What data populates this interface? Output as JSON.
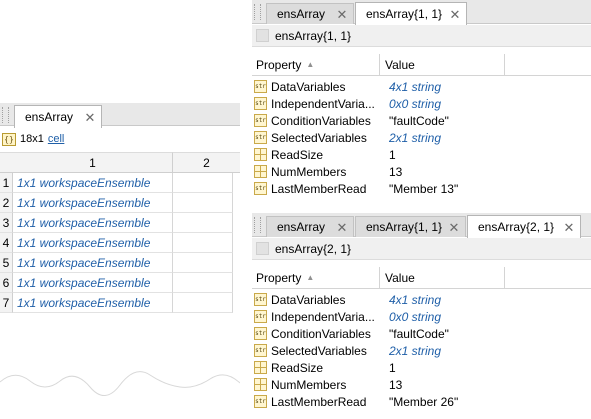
{
  "left_panel": {
    "tab_label": "ensArray",
    "size_text": "18x1",
    "class_link": "cell",
    "columns": [
      "1",
      "2"
    ],
    "rows": [
      {
        "index": "1",
        "value": "1x1 workspaceEnsemble"
      },
      {
        "index": "2",
        "value": "1x1 workspaceEnsemble"
      },
      {
        "index": "3",
        "value": "1x1 workspaceEnsemble"
      },
      {
        "index": "4",
        "value": "1x1 workspaceEnsemble"
      },
      {
        "index": "5",
        "value": "1x1 workspaceEnsemble"
      },
      {
        "index": "6",
        "value": "1x1 workspaceEnsemble"
      },
      {
        "index": "7",
        "value": "1x1 workspaceEnsemble"
      }
    ]
  },
  "top_right_panel": {
    "tabs": [
      "ensArray",
      "ensArray{1, 1}"
    ],
    "active_tab": 1,
    "variable_name": "ensArray{1, 1}",
    "header": {
      "property": "Property",
      "value": "Value"
    },
    "properties": [
      {
        "name": "DataVariables",
        "value": "4x1 string",
        "icon": "string-icon",
        "linkstyle": true
      },
      {
        "name": "IndependentVaria...",
        "value": "0x0 string",
        "icon": "string-icon",
        "linkstyle": true
      },
      {
        "name": "ConditionVariables",
        "value": "\"faultCode\"",
        "icon": "string-icon",
        "linkstyle": false
      },
      {
        "name": "SelectedVariables",
        "value": "2x1 string",
        "icon": "string-icon",
        "linkstyle": true
      },
      {
        "name": "ReadSize",
        "value": "1",
        "icon": "numeric-grid-icon",
        "linkstyle": false
      },
      {
        "name": "NumMembers",
        "value": "13",
        "icon": "numeric-grid-icon",
        "linkstyle": false
      },
      {
        "name": "LastMemberRead",
        "value": "\"Member 13\"",
        "icon": "string-icon",
        "linkstyle": false
      }
    ]
  },
  "bottom_right_panel": {
    "tabs": [
      "ensArray",
      "ensArray{1, 1}",
      "ensArray{2, 1}"
    ],
    "active_tab": 2,
    "variable_name": "ensArray{2, 1}",
    "header": {
      "property": "Property",
      "value": "Value"
    },
    "properties": [
      {
        "name": "DataVariables",
        "value": "4x1 string",
        "icon": "string-icon",
        "linkstyle": true
      },
      {
        "name": "IndependentVaria...",
        "value": "0x0 string",
        "icon": "string-icon",
        "linkstyle": true
      },
      {
        "name": "ConditionVariables",
        "value": "\"faultCode\"",
        "icon": "string-icon",
        "linkstyle": false
      },
      {
        "name": "SelectedVariables",
        "value": "2x1 string",
        "icon": "string-icon",
        "linkstyle": true
      },
      {
        "name": "ReadSize",
        "value": "1",
        "icon": "numeric-grid-icon",
        "linkstyle": false
      },
      {
        "name": "NumMembers",
        "value": "13",
        "icon": "numeric-grid-icon",
        "linkstyle": false
      },
      {
        "name": "LastMemberRead",
        "value": "\"Member 26\"",
        "icon": "string-icon",
        "linkstyle": false
      }
    ]
  },
  "icons": {
    "close": "close-icon",
    "sort": "sort-ascending-icon",
    "cell": "cell-array-icon",
    "string_label": "str"
  },
  "colors": {
    "link": "#1f5fa8",
    "tabbar": "#e8e8e8",
    "active_tab": "#ffffff"
  }
}
